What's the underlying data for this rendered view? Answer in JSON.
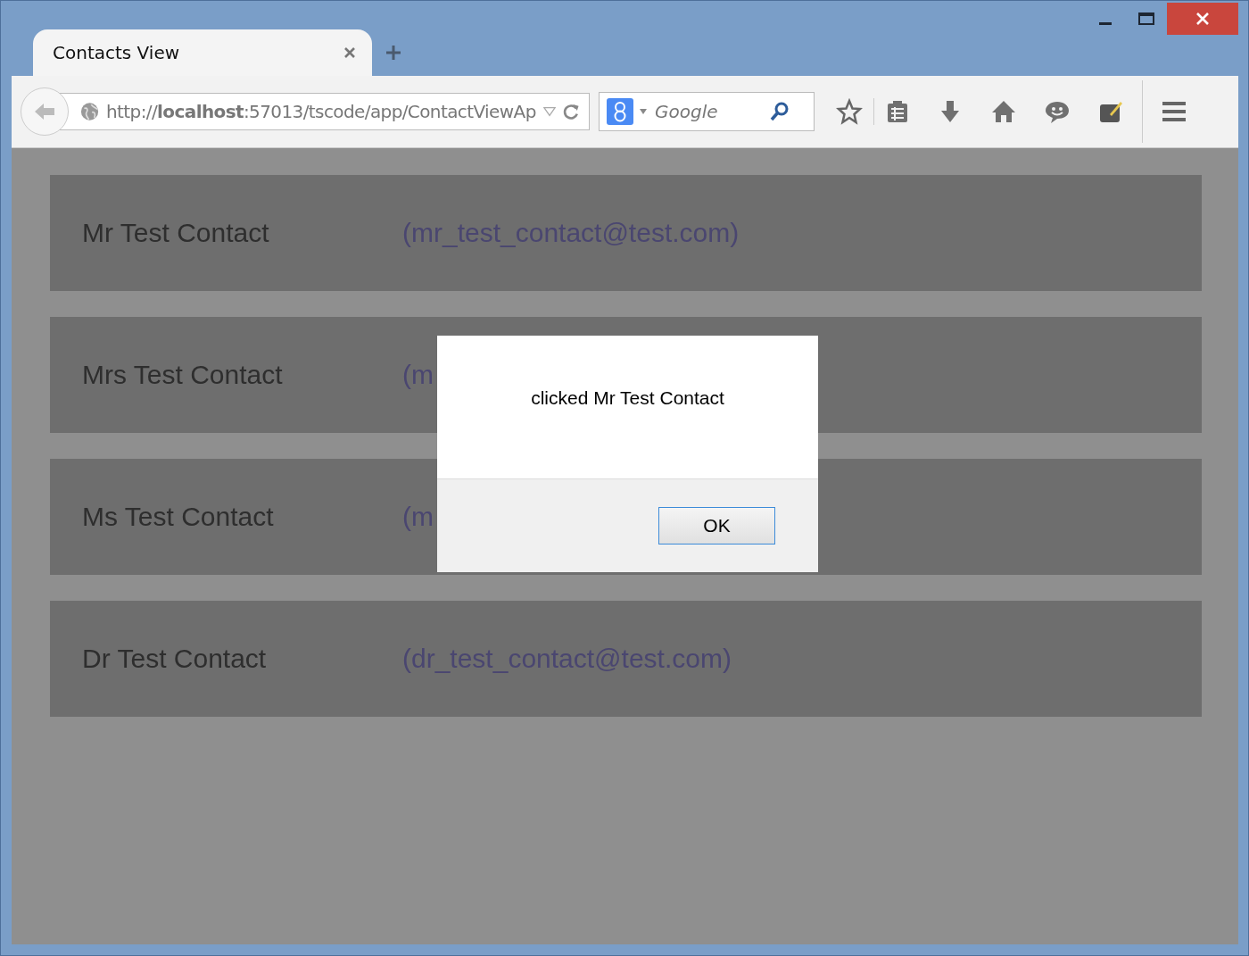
{
  "tabs": [
    {
      "title": "Contacts View",
      "selected": true
    }
  ],
  "address_bar": {
    "url": "http://**localhost**:57013/tscode/app/ContactViewAp"
  },
  "search": {
    "placeholder": "Google"
  },
  "contacts": [
    {
      "name": "Mr Test Contact",
      "email": "(mr_test_contact@test.com)"
    },
    {
      "name": "Mrs Test Contact",
      "email": "(m"
    },
    {
      "name": "Ms Test Contact",
      "email": "(m"
    },
    {
      "name": "Dr Test Contact",
      "email": "(dr_test_contact@test.com)"
    }
  ],
  "dialog": {
    "message": "clicked Mr Test Contact",
    "button": "OK"
  }
}
